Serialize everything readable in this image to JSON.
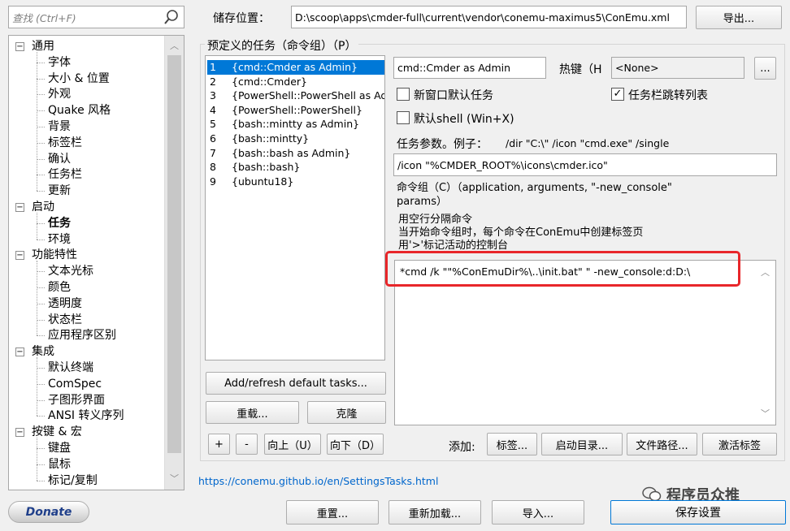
{
  "search": {
    "placeholder": "查找 (Ctrl+F)",
    "icon": "search-icon"
  },
  "storage": {
    "label": "储存位置：",
    "path": "D:\\scoop\\apps\\cmder-full\\current\\vendor\\conemu-maximus5\\ConEmu.xml",
    "export_label": "导出..."
  },
  "tree": [
    {
      "label": "通用",
      "level": 0,
      "expander": "−"
    },
    {
      "label": "字体",
      "level": 1
    },
    {
      "label": "大小 & 位置",
      "level": 1
    },
    {
      "label": "外观",
      "level": 1
    },
    {
      "label": "Quake 风格",
      "level": 1
    },
    {
      "label": "背景",
      "level": 1
    },
    {
      "label": "标签栏",
      "level": 1
    },
    {
      "label": "确认",
      "level": 1
    },
    {
      "label": "任务栏",
      "level": 1
    },
    {
      "label": "更新",
      "level": 1
    },
    {
      "label": "启动",
      "level": 0,
      "expander": "−"
    },
    {
      "label": "任务",
      "level": 1,
      "bold": true
    },
    {
      "label": "环境",
      "level": 1
    },
    {
      "label": "功能特性",
      "level": 0,
      "expander": "−"
    },
    {
      "label": "文本光标",
      "level": 1
    },
    {
      "label": "颜色",
      "level": 1
    },
    {
      "label": "透明度",
      "level": 1
    },
    {
      "label": "状态栏",
      "level": 1
    },
    {
      "label": "应用程序区别",
      "level": 1
    },
    {
      "label": "集成",
      "level": 0,
      "expander": "−"
    },
    {
      "label": "默认终端",
      "level": 1
    },
    {
      "label": "ComSpec",
      "level": 1
    },
    {
      "label": "子图形界面",
      "level": 1
    },
    {
      "label": "ANSI 转义序列",
      "level": 1
    },
    {
      "label": "按键 & 宏",
      "level": 0,
      "expander": "−"
    },
    {
      "label": "键盘",
      "level": 1
    },
    {
      "label": "鼠标",
      "level": 1
    },
    {
      "label": "标记/复制",
      "level": 1
    }
  ],
  "tasks_group": {
    "title": "预定义的任务（命令组）（P）"
  },
  "tasks": [
    {
      "num": "1",
      "name": "{cmd::Cmder as Admin}",
      "selected": true
    },
    {
      "num": "2",
      "name": "{cmd::Cmder}"
    },
    {
      "num": "3",
      "name": "{PowerShell::PowerShell as Admin}"
    },
    {
      "num": "4",
      "name": "{PowerShell::PowerShell}"
    },
    {
      "num": "5",
      "name": "{bash::mintty as Admin}"
    },
    {
      "num": "6",
      "name": "{bash::mintty}"
    },
    {
      "num": "7",
      "name": "{bash::bash as Admin}"
    },
    {
      "num": "8",
      "name": "{bash::bash}"
    },
    {
      "num": "9",
      "name": "{ubuntu18}"
    }
  ],
  "task_name": "cmd::Cmder as Admin",
  "hotkey": {
    "label": "热键（H",
    "value": "<None>",
    "more": "..."
  },
  "checkboxes": {
    "new_window": {
      "label": "新窗口默认任务",
      "checked": false
    },
    "taskbar_jump": {
      "label": "任务栏跳转列表",
      "checked": true
    },
    "default_shell": {
      "label": "默认shell (Win+X)",
      "checked": false
    }
  },
  "task_params": {
    "label": "任务参数。例子：",
    "example": "/dir \"C:\\\" /icon \"cmd.exe\" /single",
    "value": "/icon \"%CMDER_ROOT%\\icons\\cmder.ico\""
  },
  "commands": {
    "title": "命令组（C）（application, arguments, \"-new_console\" params）",
    "hint1": "用空行分隔命令",
    "hint2": "当开始命令组时，每个命令在ConEmu中创建标签页",
    "hint3": "用'>'标记活动的控制台",
    "value": "*cmd /k \"\"%ConEmuDir%\\..\\init.bat\" \" -new_console:d:D:\\"
  },
  "buttons": {
    "add_refresh": "Add/refresh default tasks...",
    "reload": "重载...",
    "clone": "克隆",
    "plus": "+",
    "minus": "-",
    "up": "向上（U）",
    "down": "向下（D）",
    "add_label": "添加:",
    "tab": "标签...",
    "start_dir": "启动目录...",
    "file_path": "文件路径...",
    "activate_tab": "激活标签",
    "reset": "重置...",
    "reload_all": "重新加载...",
    "import": "导入...",
    "save": "保存设置",
    "donate": "Donate"
  },
  "link": "https://conemu.github.io/en/SettingsTasks.html",
  "watermark": "程序员众推",
  "colors": {
    "selection": "#0078d7",
    "highlight": "#e8262a"
  }
}
